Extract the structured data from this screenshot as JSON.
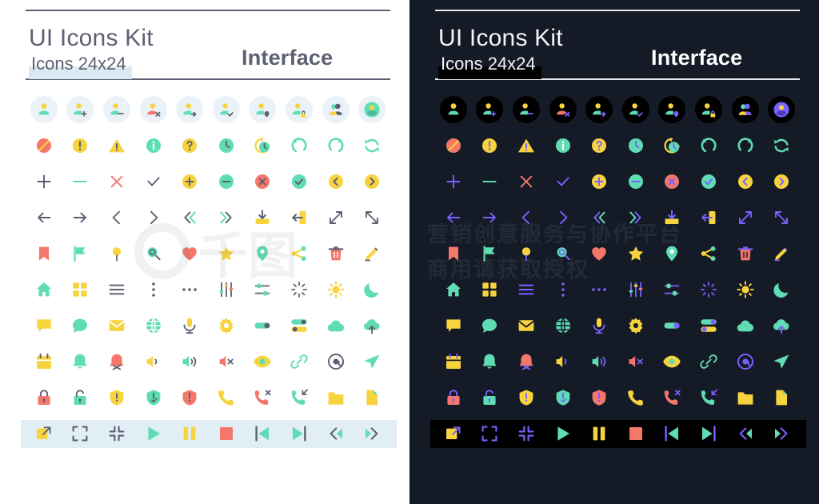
{
  "meta": {
    "title": "UI Icons Kit",
    "subtitle": "Icons 24x24",
    "kicker": "Interface"
  },
  "panels": [
    {
      "id": "light",
      "theme": "light",
      "bg": "#ffffff",
      "text": "#5c6072",
      "disc": "#eaf2f7",
      "rule": "#5c6072",
      "highlight": "#dce9f2",
      "band": "#e2eef5",
      "neutral": "#5c6072"
    },
    {
      "id": "dark",
      "theme": "dark",
      "bg": "#141a26",
      "text": "#f2f4f8",
      "disc": "#000000",
      "rule": "#e8eaf0",
      "highlight": "#000000",
      "band": "#000000",
      "neutral": "#7b61ff"
    }
  ],
  "palette": {
    "yellow": "#f7d33e",
    "mint": "#5fdcb3",
    "teal": "#56d6c0",
    "coral": "#f4776a",
    "gray": "#5c6072",
    "violet": "#7b61ff",
    "white": "#ffffff"
  },
  "rows": [
    {
      "name": "user-accounts",
      "disc": true,
      "icons": [
        "user",
        "user-add",
        "user-remove",
        "user-delete",
        "user-transfer",
        "user-check",
        "user-location",
        "user-lock",
        "users-group",
        "user-avatar"
      ]
    },
    {
      "name": "status-and-time",
      "disc": false,
      "icons": [
        "block",
        "alert-circle",
        "alert-triangle",
        "info-circle",
        "help-circle",
        "clock",
        "history",
        "undo",
        "redo",
        "refresh"
      ]
    },
    {
      "name": "actions-basic",
      "disc": false,
      "icons": [
        "plus",
        "minus",
        "close",
        "check",
        "plus-circle",
        "minus-circle",
        "close-circle",
        "check-circle",
        "chevron-left-circle",
        "chevron-right-circle"
      ]
    },
    {
      "name": "navigation-arrows",
      "disc": false,
      "icons": [
        "arrow-left",
        "arrow-right",
        "chevron-left",
        "chevron-right",
        "chevrons-left",
        "chevrons-right",
        "download-tray",
        "logout",
        "expand",
        "collapse"
      ]
    },
    {
      "name": "markers-and-edit",
      "disc": false,
      "icons": [
        "bookmark",
        "flag",
        "pin",
        "search",
        "heart",
        "star",
        "map-marker",
        "share",
        "trash",
        "pencil"
      ]
    },
    {
      "name": "layout-and-display",
      "disc": false,
      "icons": [
        "home",
        "grid",
        "menu",
        "more-vertical",
        "more-horizontal",
        "sliders-vertical",
        "sliders-horizontal",
        "spinner",
        "sun",
        "moon"
      ]
    },
    {
      "name": "communication",
      "disc": false,
      "icons": [
        "comment",
        "chat-bubble",
        "mail",
        "globe",
        "microphone",
        "gear",
        "toggle-off",
        "toggle-list",
        "cloud",
        "cloud-upload"
      ]
    },
    {
      "name": "notifications-and-media",
      "disc": false,
      "icons": [
        "calendar",
        "bell",
        "bell-off",
        "volume-low",
        "volume-high",
        "volume-mute",
        "eye",
        "link",
        "at-sign",
        "send"
      ]
    },
    {
      "name": "security-and-files",
      "disc": false,
      "icons": [
        "lock",
        "unlock",
        "shield",
        "shield-check",
        "shield-alert",
        "phone",
        "phone-missed",
        "phone-incoming",
        "folder",
        "file"
      ]
    },
    {
      "name": "player-controls",
      "disc": false,
      "band": true,
      "icons": [
        "external-link",
        "fullscreen",
        "fullscreen-exit",
        "play",
        "pause",
        "stop",
        "skip-back",
        "skip-forward",
        "rewind",
        "fast-forward"
      ]
    }
  ],
  "watermarks": {
    "light_logo": "千图",
    "dark_line1": "营销创意服务与协作平台",
    "dark_line2": "商用请获取授权"
  }
}
